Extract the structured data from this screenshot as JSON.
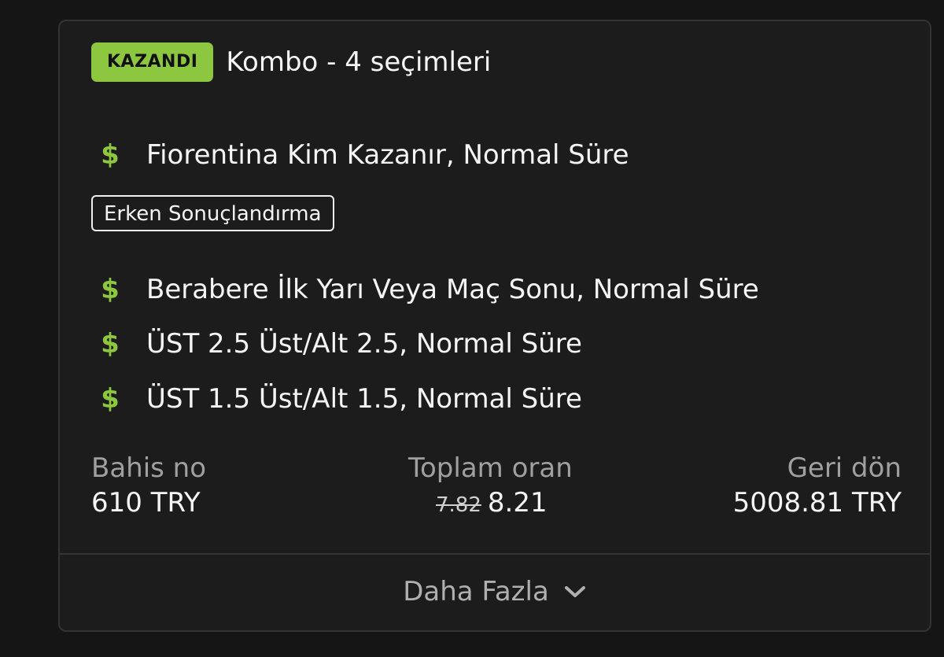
{
  "bet": {
    "status_badge": "KAZANDI",
    "title": "Kombo - 4 seçimleri",
    "selections": [
      {
        "icon": "dollar-icon",
        "label": "Fiorentina Kim Kazanır, Normal Süre"
      },
      {
        "icon": "dollar-icon",
        "label": "Berabere İlk Yarı Veya Maç Sonu, Normal Süre"
      },
      {
        "icon": "dollar-icon",
        "label": "ÜST 2.5 Üst/Alt 2.5, Normal Süre"
      },
      {
        "icon": "dollar-icon",
        "label": "ÜST 1.5 Üst/Alt 1.5, Normal Süre"
      }
    ],
    "early_settlement_tag": "Erken Sonuçlandırma",
    "summary": {
      "stake_label": "Bahis no",
      "stake_value": "610 TRY",
      "odds_label": "Toplam oran",
      "odds_old": "7.82",
      "odds_new": "8.21",
      "return_label": "Geri dön",
      "return_value": "5008.81 TRY"
    },
    "more_label": "Daha Fazla"
  },
  "colors": {
    "accent": "#8dc63f",
    "background": "#151515",
    "card": "#1c1c1c"
  }
}
